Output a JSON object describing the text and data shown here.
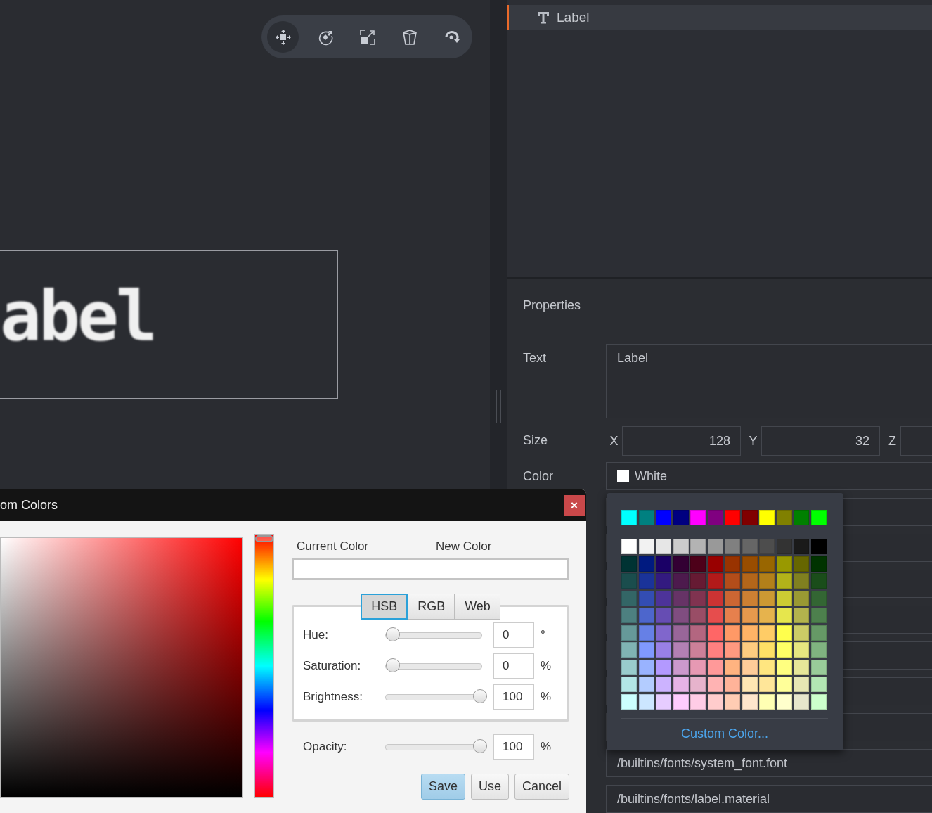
{
  "toolbar": {
    "tools": [
      {
        "kind": "move",
        "selected": true
      },
      {
        "kind": "rotate",
        "selected": false
      },
      {
        "kind": "scale",
        "selected": false
      },
      {
        "kind": "box",
        "selected": false
      },
      {
        "kind": "orbit",
        "selected": false
      }
    ]
  },
  "canvas": {
    "label_text": "abel"
  },
  "outline": {
    "items": [
      {
        "label": "Label",
        "selected": true
      }
    ]
  },
  "properties": {
    "title": "Properties",
    "text": {
      "label": "Text",
      "value": "Label"
    },
    "size": {
      "label": "Size",
      "fields": [
        {
          "axis": "X",
          "value": "128"
        },
        {
          "axis": "Y",
          "value": "32"
        },
        {
          "axis": "Z"
        }
      ]
    },
    "color": {
      "label": "Color",
      "value": "White",
      "swatch": {
        "color": "#ffffff"
      }
    },
    "resources": [
      "/builtins/fonts/system_font.font",
      "/builtins/fonts/label.material"
    ]
  },
  "color_popup": {
    "standard_colors": [
      {
        "color": "#00ffff"
      },
      {
        "color": "#008080"
      },
      {
        "color": "#0000ff"
      },
      {
        "color": "#000080"
      },
      {
        "color": "#ff00ff"
      },
      {
        "color": "#800080"
      },
      {
        "color": "#ff0000"
      },
      {
        "color": "#800000"
      },
      {
        "color": "#ffff00"
      },
      {
        "color": "#808000"
      },
      {
        "color": "#008000"
      },
      {
        "color": "#00ff00"
      }
    ],
    "palette": [
      [
        {
          "color": "#ffffff"
        },
        {
          "color": "#f2f2f2"
        },
        {
          "color": "#e6e6e6"
        },
        {
          "color": "#cccccc"
        },
        {
          "color": "#b3b3b3"
        },
        {
          "color": "#999999"
        },
        {
          "color": "#808080"
        },
        {
          "color": "#666666"
        },
        {
          "color": "#4d4d4d"
        },
        {
          "color": "#333333"
        },
        {
          "color": "#1a1a1a"
        },
        {
          "color": "#000000"
        }
      ],
      [
        {
          "color": "#003333"
        },
        {
          "color": "#001a80"
        },
        {
          "color": "#1a0066"
        },
        {
          "color": "#330033"
        },
        {
          "color": "#4d0019"
        },
        {
          "color": "#990000"
        },
        {
          "color": "#993300"
        },
        {
          "color": "#994d00"
        },
        {
          "color": "#996600"
        },
        {
          "color": "#999900"
        },
        {
          "color": "#666600"
        },
        {
          "color": "#003300"
        }
      ],
      [
        {
          "color": "#1a4d4d"
        },
        {
          "color": "#1a3399"
        },
        {
          "color": "#331a80"
        },
        {
          "color": "#4d1a4d"
        },
        {
          "color": "#661a33"
        },
        {
          "color": "#b31a1a"
        },
        {
          "color": "#b34d1a"
        },
        {
          "color": "#b3661a"
        },
        {
          "color": "#b3801a"
        },
        {
          "color": "#b3b31a"
        },
        {
          "color": "#808020"
        },
        {
          "color": "#1a4d1a"
        }
      ],
      [
        {
          "color": "#336666"
        },
        {
          "color": "#334db3"
        },
        {
          "color": "#4d3399"
        },
        {
          "color": "#663366"
        },
        {
          "color": "#803350"
        },
        {
          "color": "#cc3333"
        },
        {
          "color": "#cc6633"
        },
        {
          "color": "#cc8033"
        },
        {
          "color": "#cc9933"
        },
        {
          "color": "#cccc33"
        },
        {
          "color": "#999933"
        },
        {
          "color": "#336633"
        }
      ],
      [
        {
          "color": "#4d8080"
        },
        {
          "color": "#4d66cc"
        },
        {
          "color": "#664db3"
        },
        {
          "color": "#804d80"
        },
        {
          "color": "#994d66"
        },
        {
          "color": "#e64d4d"
        },
        {
          "color": "#e6804d"
        },
        {
          "color": "#e6994d"
        },
        {
          "color": "#e6b34d"
        },
        {
          "color": "#e6e64d"
        },
        {
          "color": "#b3b34d"
        },
        {
          "color": "#4d804d"
        }
      ],
      [
        {
          "color": "#669999"
        },
        {
          "color": "#6680e6"
        },
        {
          "color": "#8066cc"
        },
        {
          "color": "#996699"
        },
        {
          "color": "#b36680"
        },
        {
          "color": "#ff6666"
        },
        {
          "color": "#ff9966"
        },
        {
          "color": "#ffb366"
        },
        {
          "color": "#ffcc66"
        },
        {
          "color": "#ffff4d"
        },
        {
          "color": "#cccc66"
        },
        {
          "color": "#669966"
        }
      ],
      [
        {
          "color": "#80b3b3"
        },
        {
          "color": "#8099ff"
        },
        {
          "color": "#9980e6"
        },
        {
          "color": "#b380b3"
        },
        {
          "color": "#cc8099"
        },
        {
          "color": "#ff8080"
        },
        {
          "color": "#ff9980"
        },
        {
          "color": "#ffcc80"
        },
        {
          "color": "#ffe066"
        },
        {
          "color": "#ffff66"
        },
        {
          "color": "#e6e680"
        },
        {
          "color": "#80b380"
        }
      ],
      [
        {
          "color": "#99cccc"
        },
        {
          "color": "#99b3ff"
        },
        {
          "color": "#b399ff"
        },
        {
          "color": "#cc99cc"
        },
        {
          "color": "#e699b3"
        },
        {
          "color": "#ff9999"
        },
        {
          "color": "#ffb380"
        },
        {
          "color": "#ffcc99"
        },
        {
          "color": "#ffe680"
        },
        {
          "color": "#ffff80"
        },
        {
          "color": "#e6e699"
        },
        {
          "color": "#99cc99"
        }
      ],
      [
        {
          "color": "#b3e6e6"
        },
        {
          "color": "#b3ccff"
        },
        {
          "color": "#ccb3ff"
        },
        {
          "color": "#e6b3e6"
        },
        {
          "color": "#e6b3cc"
        },
        {
          "color": "#ffb3b3"
        },
        {
          "color": "#ffb399"
        },
        {
          "color": "#ffe6b3"
        },
        {
          "color": "#ffe699"
        },
        {
          "color": "#ffff99"
        },
        {
          "color": "#e6e6b3"
        },
        {
          "color": "#b3e6b3"
        }
      ],
      [
        {
          "color": "#ccffff"
        },
        {
          "color": "#cce6ff"
        },
        {
          "color": "#e6ccff"
        },
        {
          "color": "#ffccff"
        },
        {
          "color": "#ffcce6"
        },
        {
          "color": "#ffcccc"
        },
        {
          "color": "#ffccb3"
        },
        {
          "color": "#ffe6cc"
        },
        {
          "color": "#ffffb3"
        },
        {
          "color": "#ffffcc"
        },
        {
          "color": "#e6e6cc"
        },
        {
          "color": "#ccffcc"
        }
      ]
    ],
    "custom_link": "Custom Color..."
  },
  "dialog": {
    "title": "om Colors",
    "close_glyph": "×",
    "hue_bar": {
      "level": 0
    },
    "current_color_label": "Current Color",
    "new_color_label": "New Color",
    "current_color": {
      "color": "#ffffff"
    },
    "new_color": {
      "color": "#ffffff"
    },
    "tabs": [
      {
        "label": "HSB",
        "selected": true
      },
      {
        "label": "RGB",
        "selected": false
      },
      {
        "label": "Web",
        "selected": false
      }
    ],
    "sliders": [
      {
        "label": "Hue:",
        "level": 0,
        "value": "0",
        "unit": "°"
      },
      {
        "label": "Saturation:",
        "level": 0,
        "value": "0",
        "unit": "%"
      },
      {
        "label": "Brightness:",
        "level": 1,
        "value": "100",
        "unit": "%"
      }
    ],
    "opacity": {
      "label": "Opacity:",
      "level": 1,
      "value": "100",
      "unit": "%"
    },
    "buttons": [
      {
        "label": "Save",
        "default": true
      },
      {
        "label": "Use",
        "default": false
      },
      {
        "label": "Cancel",
        "default": false
      }
    ]
  }
}
